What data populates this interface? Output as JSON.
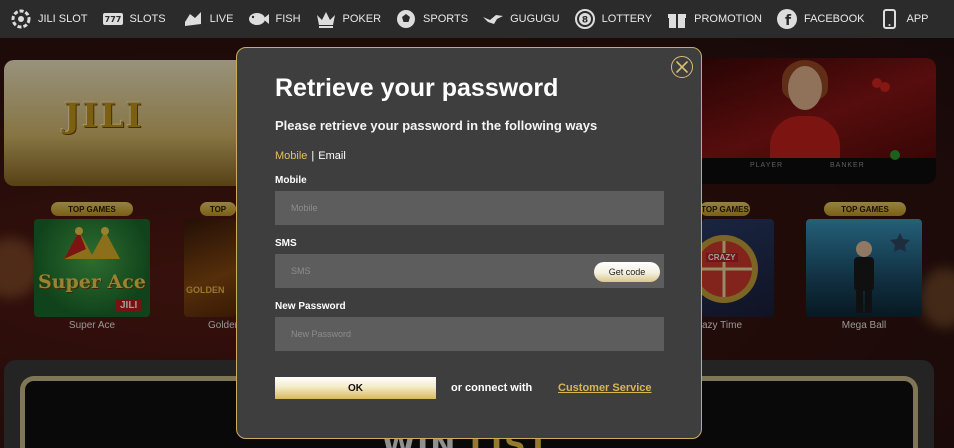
{
  "nav": {
    "items": [
      {
        "label": "JILI SLOT",
        "icon": "gear-spin-icon"
      },
      {
        "label": "SLOTS",
        "icon": "slot-777-icon"
      },
      {
        "label": "LIVE",
        "icon": "live-hand-icon"
      },
      {
        "label": "FISH",
        "icon": "fish-icon"
      },
      {
        "label": "POKER",
        "icon": "crown-icon"
      },
      {
        "label": "SPORTS",
        "icon": "soccer-ball-icon"
      },
      {
        "label": "GUGUGU",
        "icon": "bird-icon"
      },
      {
        "label": "LOTTERY",
        "icon": "lottery-ball-icon"
      },
      {
        "label": "PROMOTION",
        "icon": "gift-icon"
      },
      {
        "label": "FACEBOOK",
        "icon": "facebook-icon"
      },
      {
        "label": "APP",
        "icon": "phone-icon"
      }
    ]
  },
  "background": {
    "banner_logo": "JILI",
    "banner_table_left": "PLAYER",
    "banner_table_right": "BANKER",
    "games": [
      {
        "badge": "TOP GAMES",
        "name": "Super Ace",
        "thumb_text": "Super Ace",
        "thumb_brand": "JILI"
      },
      {
        "badge": "TOP",
        "name": "Golden",
        "thumb_text": "GOLDEN"
      },
      {
        "badge": "TOP GAMES",
        "name": "azy Time",
        "thumb_text": "CRAZY"
      },
      {
        "badge": "TOP GAMES",
        "name": "Mega Ball"
      }
    ],
    "win_list_a": "WIN",
    "win_list_b": "LIST"
  },
  "modal": {
    "title": "Retrieve your password",
    "subtitle": "Please retrieve your password in the following ways",
    "tab_mobile": "Mobile",
    "tab_separator": "|",
    "tab_email": "Email",
    "mobile_label": "Mobile",
    "mobile_placeholder": "Mobile",
    "sms_label": "SMS",
    "sms_placeholder": "SMS",
    "get_code": "Get code",
    "password_label": "New Password",
    "password_placeholder": "New Password",
    "ok": "OK",
    "or_connect": "or connect with",
    "customer_service": "Customer Service"
  },
  "colors": {
    "accent_gold": "#d9b552",
    "nav_bg": "#2b2b2b",
    "modal_bg": "#3e3e3e",
    "input_bg": "#5d5d5d"
  }
}
